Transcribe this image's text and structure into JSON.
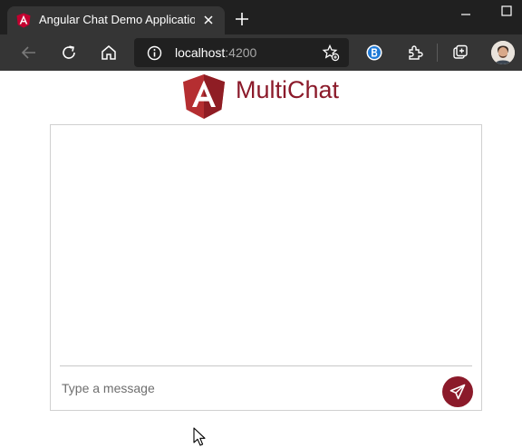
{
  "browser": {
    "tab": {
      "title": "Angular Chat Demo Application",
      "favicon": "angular-icon"
    },
    "address": {
      "host": "localhost",
      "port": ":4200"
    },
    "toolbar_icons": [
      "back-icon",
      "refresh-icon",
      "home-icon",
      "info-icon",
      "favorites-add-icon",
      "bing-icon",
      "extensions-icon",
      "collections-icon",
      "profile-avatar"
    ]
  },
  "app": {
    "brand": "MultiChat",
    "accent_color": "#8b1a2a",
    "composer": {
      "placeholder": "Type a message",
      "value": "",
      "send_icon": "send-icon"
    }
  }
}
